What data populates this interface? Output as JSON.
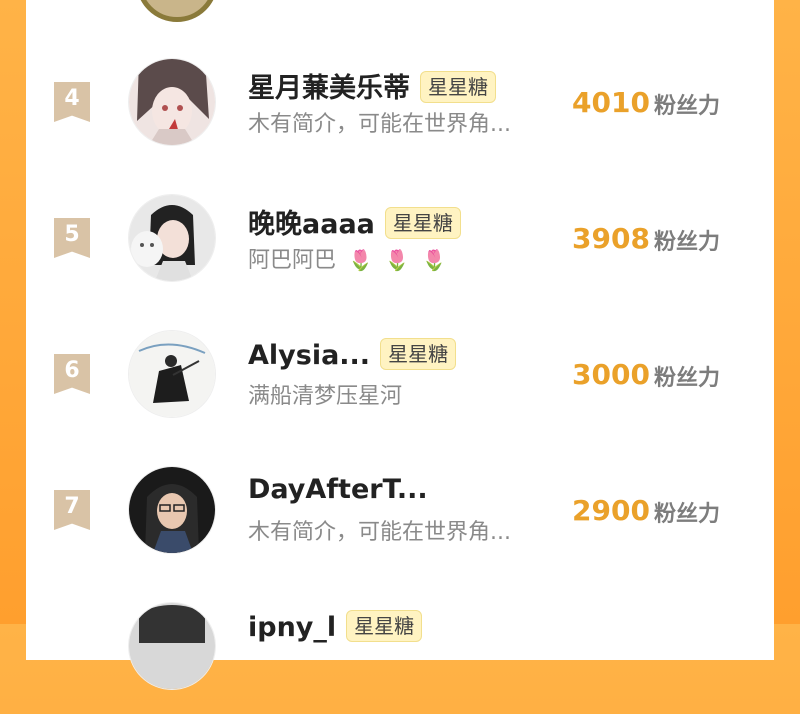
{
  "colors": {
    "accent": "#eaa12a",
    "background": "#ff9f2e",
    "badge_bg": "#fff3c2",
    "rank_bg": "#d9c3a6"
  },
  "rows": [
    {
      "rank": "4",
      "name": "星月蒹美乐蒂",
      "badge": "星星糖",
      "bio": "木有简介，可能在世界角...",
      "count": "4010",
      "unit": "粉丝力"
    },
    {
      "rank": "5",
      "name": "晚晚aaaa",
      "badge": "星星糖",
      "bio": "阿巴阿巴",
      "bio_icons": [
        "🌷",
        "🌷",
        "🌷"
      ],
      "count": "3908",
      "unit": "粉丝力"
    },
    {
      "rank": "6",
      "name": "Alysia...",
      "badge": "星星糖",
      "bio": "满船清梦压星河",
      "count": "3000",
      "unit": "粉丝力"
    },
    {
      "rank": "7",
      "name": "DayAfterT...",
      "badge": "",
      "bio": "木有简介，可能在世界角...",
      "count": "2900",
      "unit": "粉丝力"
    },
    {
      "rank": "",
      "name": "ipny_l",
      "badge": "星星糖",
      "bio": "",
      "count": "",
      "unit": ""
    }
  ]
}
